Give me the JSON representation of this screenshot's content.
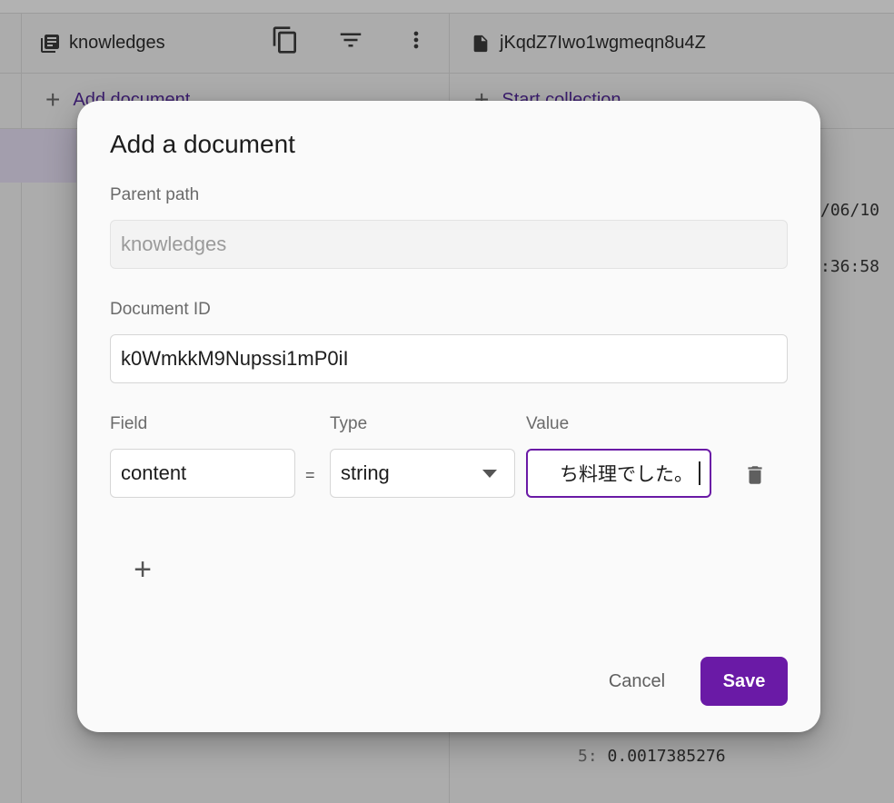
{
  "background": {
    "collection_title": "knowledges",
    "document_title": "jKqdZ7Iwo1wgmeqn8u4Z",
    "add_document_label": "Add document",
    "start_collection_label": "Start collection",
    "field_date_fragment": "/06/10",
    "field_time_fragment": ":36:58",
    "vector_row_index": "5:",
    "vector_row_value": "0.0017385276"
  },
  "dialog": {
    "title": "Add a document",
    "parent_path_label": "Parent path",
    "parent_path_value": "knowledges",
    "document_id_label": "Document ID",
    "document_id_value": "k0WmkkM9Nupssi1mP0iI",
    "field_label": "Field",
    "type_label": "Type",
    "value_label": "Value",
    "field_value": "content",
    "equals_sign": "=",
    "type_value": "string",
    "value_value": "ち料理でした。",
    "add_field_symbol": "+",
    "cancel_label": "Cancel",
    "save_label": "Save"
  },
  "colors": {
    "accent": "#6a1aa6",
    "scrim": "#acacac",
    "dialog_bg": "#fafafa"
  },
  "icons": {
    "collection": "collection-icon",
    "document": "document-icon",
    "copy": "copy-icon",
    "filter": "filter-icon",
    "more": "more-vert-icon",
    "delete": "trash-icon",
    "add": "plus-icon"
  }
}
